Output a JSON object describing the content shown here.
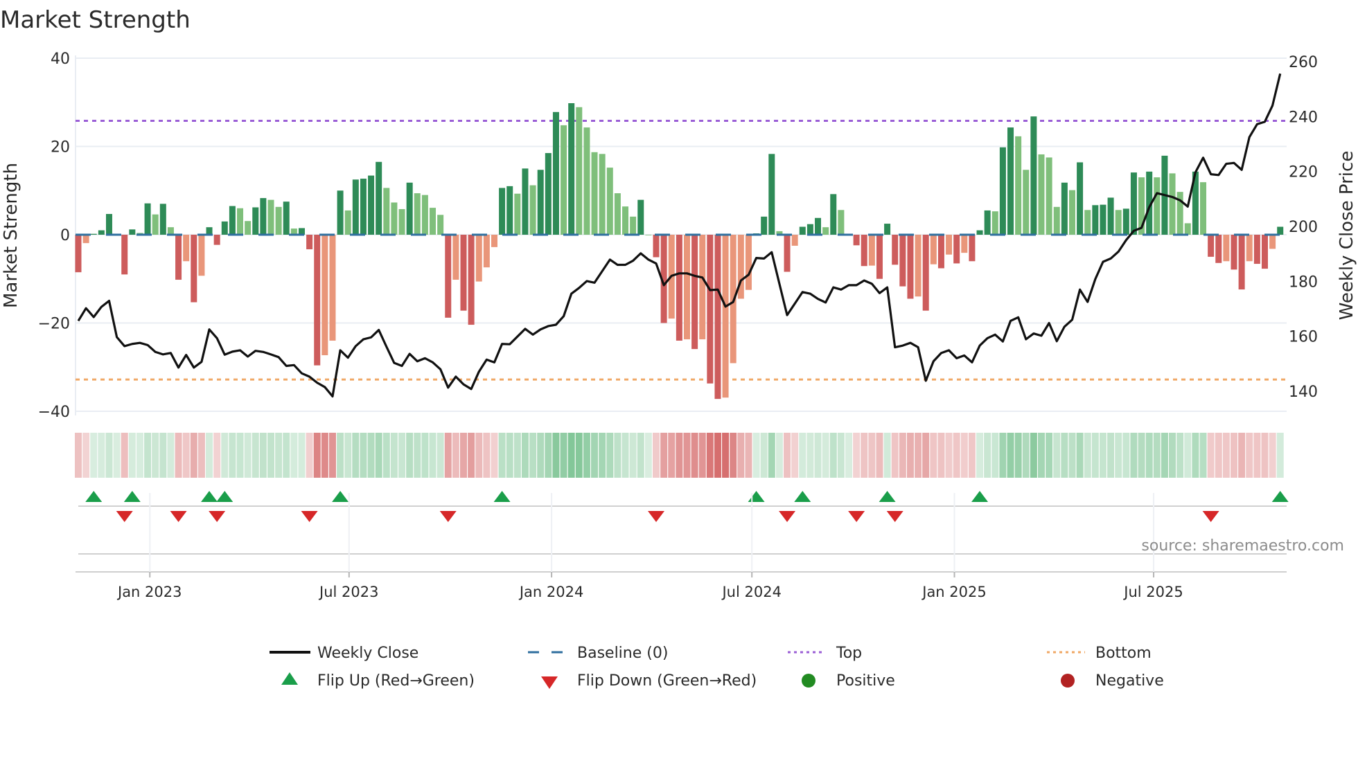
{
  "chart_data": {
    "type": "bar",
    "title": "Market Strength",
    "ylabel": "Market Strength",
    "y2label": "Weekly Close Price",
    "ylim": [
      -40,
      40
    ],
    "y2lim": [
      140,
      260
    ],
    "yticks": [
      40,
      20,
      0,
      -20,
      -40
    ],
    "ytick_labels": [
      "40",
      "20",
      "0",
      "−20",
      "−40"
    ],
    "y2ticks": [
      260,
      240,
      220,
      200,
      180,
      160,
      140
    ],
    "y2tick_labels": [
      "260",
      "240",
      "220",
      "200",
      "180",
      "160",
      "140"
    ],
    "x_start": "2022-10-28",
    "x_step_days": 7,
    "xticks": [
      {
        "date": "2023-01-01",
        "label": "Jan 2023"
      },
      {
        "date": "2023-07-01",
        "label": "Jul 2023"
      },
      {
        "date": "2024-01-01",
        "label": "Jan 2024"
      },
      {
        "date": "2024-07-01",
        "label": "Jul 2024"
      },
      {
        "date": "2025-01-01",
        "label": "Jan 2025"
      },
      {
        "date": "2025-07-01",
        "label": "Jul 2025"
      }
    ],
    "top_level": 25.8,
    "bottom_level": -32.8,
    "baseline": 0,
    "series": [
      {
        "name": "Market Strength",
        "axis": "left",
        "type": "bar",
        "values": [
          -8.5,
          -1.9,
          0.2,
          1,
          4.7,
          0,
          -9,
          1.2,
          0.4,
          7.1,
          4.6,
          7,
          1.7,
          -10.2,
          -6,
          -15.3,
          -9.3,
          1.7,
          -2.3,
          3,
          6.5,
          6,
          3.1,
          6.2,
          8.3,
          7.9,
          6.3,
          7.5,
          1.4,
          1.5,
          -3.3,
          -29.6,
          -27.3,
          -24,
          10,
          5.5,
          12.5,
          12.7,
          13.4,
          16.5,
          10.6,
          7.3,
          5.8,
          11.8,
          9.4,
          9,
          6.1,
          4.5,
          -18.8,
          -10.2,
          -17.2,
          -20.4,
          -10.6,
          -7.4,
          -2.8,
          10.6,
          11,
          9.3,
          15,
          11.2,
          14.7,
          18.5,
          27.8,
          24.8,
          29.8,
          28.9,
          24.3,
          18.7,
          18.3,
          15.2,
          9.4,
          6.4,
          4.1,
          7.9,
          0,
          -5.1,
          -20,
          -19,
          -24,
          -23.7,
          -25.9,
          -23.7,
          -33.7,
          -37.2,
          -36.9,
          -29.1,
          -14.5,
          -12.5,
          0.3,
          4.1,
          18.3,
          0.8,
          -8.4,
          -2.5,
          1.8,
          2.4,
          3.8,
          1.7,
          9.2,
          5.6,
          0,
          -2.4,
          -7.1,
          -7,
          -10,
          2.5,
          -6.8,
          -11.7,
          -14.5,
          -14,
          -17.2,
          -6.7,
          -7.6,
          -4.5,
          -6.5,
          -4.1,
          -6,
          1,
          5.5,
          5.3,
          19.8,
          24.3,
          22.3,
          14.7,
          26.8,
          18.2,
          17.5,
          6.3,
          11.8,
          10.1,
          16.4,
          5.6,
          6.7,
          6.8,
          8.4,
          5.6,
          5.9,
          14.1,
          13,
          14.3,
          13,
          17.9,
          13.9,
          9.7,
          2.6,
          14.3,
          11.9,
          -5,
          -6.4,
          -6,
          -7.9,
          -12.4,
          -6,
          -6.6,
          -7.7,
          -3.2,
          1.8
        ]
      },
      {
        "name": "Weekly Close",
        "axis": "right",
        "type": "line",
        "values": [
          165.6,
          170.2,
          167,
          170.7,
          172.9,
          159.7,
          156.4,
          157.2,
          157.6,
          156.8,
          154.3,
          153.4,
          153.9,
          148.6,
          153.2,
          148.6,
          150.7,
          162.5,
          159.3,
          153.3,
          154.4,
          154.9,
          152.6,
          154.7,
          154.3,
          153.4,
          152.4,
          149.2,
          149.5,
          146.5,
          145.3,
          143.1,
          141.5,
          138.1,
          154.9,
          152.2,
          156.4,
          158.9,
          159.6,
          162.3,
          156.2,
          150.3,
          149.2,
          153.6,
          150.9,
          152,
          150.5,
          148,
          141.3,
          145.3,
          142.5,
          140.8,
          147.1,
          151.5,
          150.5,
          157.2,
          157.1,
          159.9,
          162.7,
          160.6,
          162.5,
          163.7,
          164.2,
          167.3,
          175.5,
          177.6,
          180.1,
          179.5,
          183.7,
          187.9,
          186,
          186,
          187.5,
          190.2,
          187.9,
          186.5,
          178.6,
          182,
          182.9,
          182.9,
          182,
          181.4,
          176.8,
          177,
          170.8,
          172.5,
          180.3,
          182.4,
          188.5,
          188.3,
          190.6,
          179.1,
          167.7,
          171.9,
          176.1,
          175.5,
          173.6,
          172.3,
          177.8,
          177,
          178.6,
          178.6,
          180.3,
          179.1,
          175.7,
          177.8,
          156,
          156.6,
          157.6,
          156,
          143.8,
          150.9,
          153.9,
          154.9,
          152,
          153,
          150.5,
          156.6,
          159.3,
          160.6,
          158.1,
          165.6,
          166.9,
          158.9,
          161,
          160.2,
          164.8,
          158.2,
          163.5,
          166,
          177,
          172.5,
          180.8,
          187.1,
          188.3,
          190.8,
          195,
          198.4,
          199.5,
          207,
          212.1,
          211.4,
          210.7,
          209.5,
          207.2,
          219.7,
          225,
          219,
          218.7,
          222.8,
          223.1,
          220.6,
          232.5,
          237.2,
          238.1,
          244,
          255.6
        ]
      }
    ],
    "legend": {
      "placement": "bottom",
      "items": [
        {
          "label": "Weekly Close",
          "symbol": "line"
        },
        {
          "label": "Baseline (0)",
          "symbol": "dash"
        },
        {
          "label": "Top",
          "symbol": "dot-purple"
        },
        {
          "label": "Bottom",
          "symbol": "dot-orange"
        },
        {
          "label": "Flip Up (Red→Green)",
          "symbol": "triangle-up"
        },
        {
          "label": "Flip Down (Green→Red)",
          "symbol": "triangle-down"
        },
        {
          "label": "Positive",
          "symbol": "circle-green"
        },
        {
          "label": "Negative",
          "symbol": "circle-red"
        }
      ]
    },
    "annotation": "source: sharemaestro.com"
  },
  "colors": {
    "pos_rising": "#2e8b57",
    "pos_falling": "#7fbf7b",
    "neg_falling": "#cd5c5c",
    "neg_rising": "#e9967a",
    "top": "#9b5fd6",
    "bottom": "#f0a866",
    "baseline": "#2f6f9f",
    "flip_up": "#1a9e4a",
    "flip_down": "#d62728",
    "positive": "#228b22",
    "negative": "#b22222",
    "line": "#111111"
  }
}
